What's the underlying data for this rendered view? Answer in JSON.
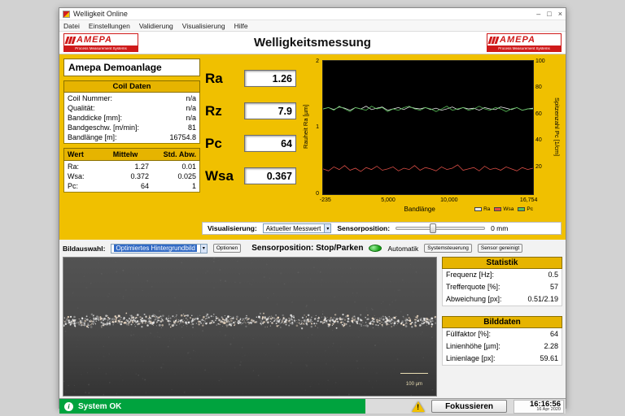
{
  "window": {
    "title": "Welligkeit Online",
    "menu": [
      "Datei",
      "Einstellungen",
      "Validierung",
      "Visualisierung",
      "Hilfe"
    ],
    "header_title": "Welligkeitsmessung",
    "controls": {
      "minimize": "–",
      "maximize": "□",
      "close": "×"
    }
  },
  "logo": {
    "brand": "AMEPA",
    "subtitle": "Process Measurement Systems"
  },
  "plant_name": "Amepa Demoanlage",
  "coil": {
    "header": "Coil Daten",
    "rows": [
      {
        "label": "Coil Nummer:",
        "value": "n/a"
      },
      {
        "label": "Qualität:",
        "value": "n/a"
      },
      {
        "label": "Banddicke [mm]:",
        "value": "n/a"
      },
      {
        "label": "Bandgeschw. [m/min]:",
        "value": "81"
      },
      {
        "label": "Bandlänge [m]:",
        "value": "16754.8"
      }
    ]
  },
  "wert_table": {
    "headers": [
      "Wert",
      "Mittelw",
      "Std. Abw."
    ],
    "rows": [
      {
        "name": "Ra:",
        "mittelw": "1.27",
        "std": "0.01"
      },
      {
        "name": "Wsa:",
        "mittelw": "0.372",
        "std": "0.025"
      },
      {
        "name": "Pc:",
        "mittelw": "64",
        "std": "1"
      }
    ]
  },
  "readouts": [
    {
      "label": "Ra",
      "value": "1.26"
    },
    {
      "label": "Rz",
      "value": "7.9"
    },
    {
      "label": "Pc",
      "value": "64"
    },
    {
      "label": "Wsa",
      "value": "0.367"
    }
  ],
  "chart_data": {
    "type": "line",
    "title": "",
    "xlabel": "Bandlänge",
    "ylabel_left": "Rauheit Ra [µm]",
    "ylabel_right": "Spitzenzahl Pc [1/cm]",
    "xlim": [
      -235,
      16754
    ],
    "x_ticks": [
      "-235",
      "5,000",
      "10,000",
      "16,754"
    ],
    "ylim_left": [
      0,
      2
    ],
    "ylim_right": [
      0,
      100
    ],
    "y_ticks_left": [
      "2",
      "1",
      "0"
    ],
    "y_ticks_right": [
      "100",
      "80",
      "60",
      "40",
      "20"
    ],
    "grid": false,
    "legend": [
      "Ra",
      "Wsa",
      "Pc"
    ],
    "legend_position": "bottom-right",
    "series": [
      {
        "name": "Ra",
        "axis": "left",
        "color": "#e8e8e8",
        "values": [
          1.28,
          1.3,
          1.27,
          1.31,
          1.29,
          1.26,
          1.3,
          1.28,
          1.32,
          1.27,
          1.29,
          1.31,
          1.26,
          1.28,
          1.3,
          1.27,
          1.31,
          1.29,
          1.28,
          1.3,
          1.27,
          1.29,
          1.26,
          1.28,
          1.31,
          1.27,
          1.3,
          1.28,
          1.29,
          1.26,
          1.3,
          1.28,
          1.27,
          1.31,
          1.29,
          1.27,
          1.3,
          1.26,
          1.28,
          1.29
        ]
      },
      {
        "name": "Pc",
        "axis": "right",
        "color": "#58c058",
        "values": [
          64,
          65,
          63,
          66,
          64,
          62,
          65,
          64,
          63,
          66,
          64,
          65,
          62,
          64,
          63,
          65,
          66,
          64,
          63,
          65,
          64,
          62,
          64,
          66,
          63,
          64,
          65,
          63,
          64,
          66,
          64,
          63,
          65,
          64,
          62,
          64,
          65,
          63,
          64,
          64
        ]
      },
      {
        "name": "Wsa",
        "axis": "left",
        "color": "#e05048",
        "values": [
          0.38,
          0.35,
          0.41,
          0.37,
          0.43,
          0.36,
          0.39,
          0.34,
          0.4,
          0.37,
          0.42,
          0.36,
          0.38,
          0.41,
          0.35,
          0.39,
          0.37,
          0.43,
          0.36,
          0.4,
          0.38,
          0.35,
          0.41,
          0.37,
          0.39,
          0.44,
          0.36,
          0.38,
          0.4,
          0.35,
          0.42,
          0.37,
          0.39,
          0.36,
          0.41,
          0.38,
          0.35,
          0.4,
          0.37,
          0.39
        ]
      }
    ]
  },
  "visualisierung": {
    "label": "Visualisierung:",
    "selected": "Aktueller Messwert",
    "sensor_label": "Sensorposition:",
    "sensor_value": "0 mm"
  },
  "bildauswahl": {
    "label": "Bildauswahl:",
    "selected": "Optimiertes Hintergrundbild",
    "optionen_button": "Optionen",
    "sensorposition_label": "Sensorposition: Stop/Parken",
    "automatik_label": "Automatik",
    "systemsteuerung_button": "Systemsteuerung",
    "sensor_gereinigt_button": "Sensor gereinigt"
  },
  "camera": {
    "scale_label": "100 µm"
  },
  "statistik": {
    "header": "Statistik",
    "rows": [
      {
        "label": "Frequenz [Hz]:",
        "value": "0.5"
      },
      {
        "label": "Trefferquote [%]:",
        "value": "57"
      },
      {
        "label": "Abweichung [px]:",
        "value": "0.51/2.19"
      }
    ]
  },
  "bilddaten": {
    "header": "Bilddaten",
    "rows": [
      {
        "label": "Füllfaktor [%]:",
        "value": "64"
      },
      {
        "label": "Linienhöhe [µm]:",
        "value": "2.28"
      },
      {
        "label": "Linienlage [px]:",
        "value": "59.61"
      }
    ]
  },
  "statusbar": {
    "status_text": "System OK",
    "fokussieren_button": "Fokussieren",
    "time": "16:16:56",
    "date": "16 Apr 2020"
  },
  "colors": {
    "amepa_yellow": "#f0c000",
    "amepa_red": "#cf1a1a",
    "status_green": "#00a33e",
    "chart_background": "#000000",
    "line_ra": "#e8e8e8",
    "line_pc": "#58c058",
    "line_wsa": "#e05048"
  }
}
